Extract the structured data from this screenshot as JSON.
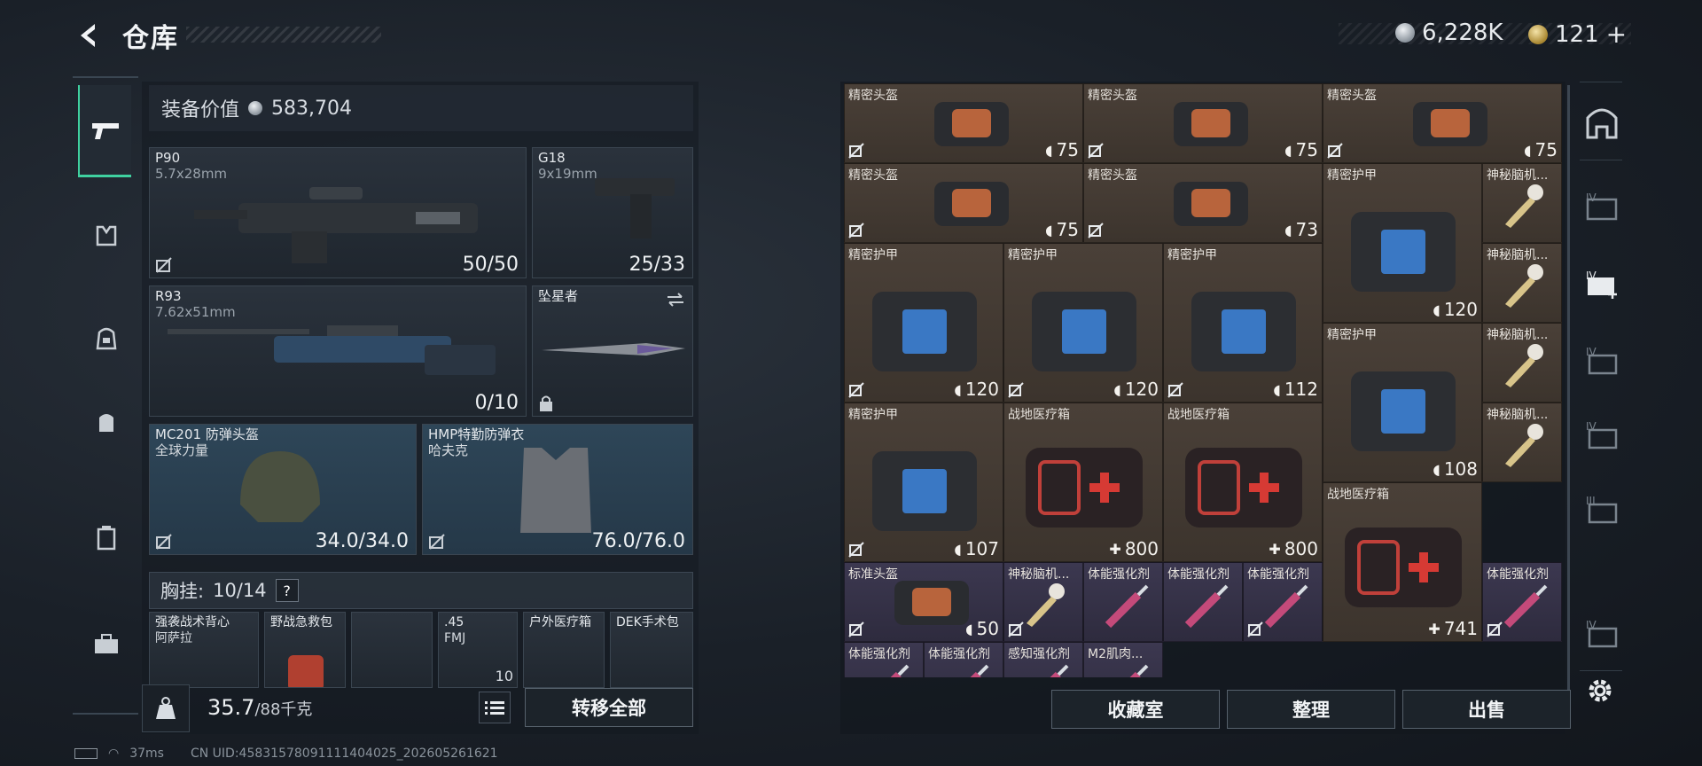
{
  "header": {
    "title": "仓库",
    "currency_silver": "6,228K",
    "currency_gold": "121"
  },
  "equipment": {
    "value_label": "装备价值",
    "value": "583,704",
    "primary": {
      "name": "P90",
      "ammo": "5.7x28mm",
      "count": "50/50"
    },
    "secondary": {
      "name": "G18",
      "ammo": "9x19mm",
      "count": "25/33"
    },
    "sniper": {
      "name": "R93",
      "ammo": "7.62x51mm",
      "count": "0/10"
    },
    "melee": {
      "name": "坠星者"
    },
    "helmet": {
      "name": "MC201 防弹头盔",
      "sub": "全球力量",
      "durability": "34.0/34.0"
    },
    "armor": {
      "name": "HMP特勤防弹衣",
      "sub": "哈夫克",
      "durability": "76.0/76.0"
    },
    "rig_label": "胸挂:",
    "rig_capacity": "10/14",
    "rig_help": "?",
    "rig_items": [
      {
        "name": "强袭战术背心",
        "sub": "阿萨拉"
      },
      {
        "name": "野战急救包",
        "sub": ""
      },
      {
        "name": "",
        "sub": ""
      },
      {
        "name": ".45",
        "sub": "FMJ",
        "qty": "10"
      },
      {
        "name": "户外医疗箱",
        "sub": ""
      },
      {
        "name": "DEK手术包",
        "sub": ""
      }
    ],
    "weight": "35.7",
    "weight_max": "/88千克",
    "transfer_all": "转移全部"
  },
  "storage": {
    "cells": [
      {
        "name": "精密头盔",
        "value": "75"
      },
      {
        "name": "精密头盔",
        "value": "75"
      },
      {
        "name": "精密头盔",
        "value": "75"
      },
      {
        "name": "精密头盔",
        "value": "75"
      },
      {
        "name": "精密头盔",
        "value": "73"
      },
      {
        "name": "精密护甲",
        "value": "120"
      },
      {
        "name": "神秘脑机...",
        "value": ""
      },
      {
        "name": "精密护甲",
        "value": "120"
      },
      {
        "name": "精密护甲",
        "value": "120"
      },
      {
        "name": "精密护甲",
        "value": "112"
      },
      {
        "name": "神秘脑机...",
        "value": ""
      },
      {
        "name": "精密护甲",
        "value": "108"
      },
      {
        "name": "神秘脑机...",
        "value": ""
      },
      {
        "name": "精密护甲",
        "value": "107"
      },
      {
        "name": "战地医疗箱",
        "value": "800"
      },
      {
        "name": "战地医疗箱",
        "value": "800"
      },
      {
        "name": "神秘脑机...",
        "value": ""
      },
      {
        "name": "战地医疗箱",
        "value": "741"
      },
      {
        "name": "标准头盔",
        "value": "50"
      },
      {
        "name": "神秘脑机...",
        "value": ""
      },
      {
        "name": "体能强化剂",
        "value": ""
      },
      {
        "name": "体能强化剂",
        "value": ""
      },
      {
        "name": "体能强化剂",
        "value": ""
      },
      {
        "name": "体能强化剂",
        "value": ""
      },
      {
        "name": "体能强化剂",
        "value": ""
      },
      {
        "name": "感知强化剂",
        "value": ""
      },
      {
        "name": "M2肌肉...",
        "value": ""
      }
    ],
    "collection_btn": "收藏室",
    "sort_btn": "整理",
    "sell_btn": "出售"
  },
  "footer": {
    "ping": "37ms",
    "uid": "CN UID:45831578091111404025_202605261621"
  },
  "colors": {
    "accent": "#3fd1a0",
    "item_bg_brown": "#4a4038",
    "item_bg_purple": "#3c3850",
    "slot_blue": "#2e4658"
  }
}
